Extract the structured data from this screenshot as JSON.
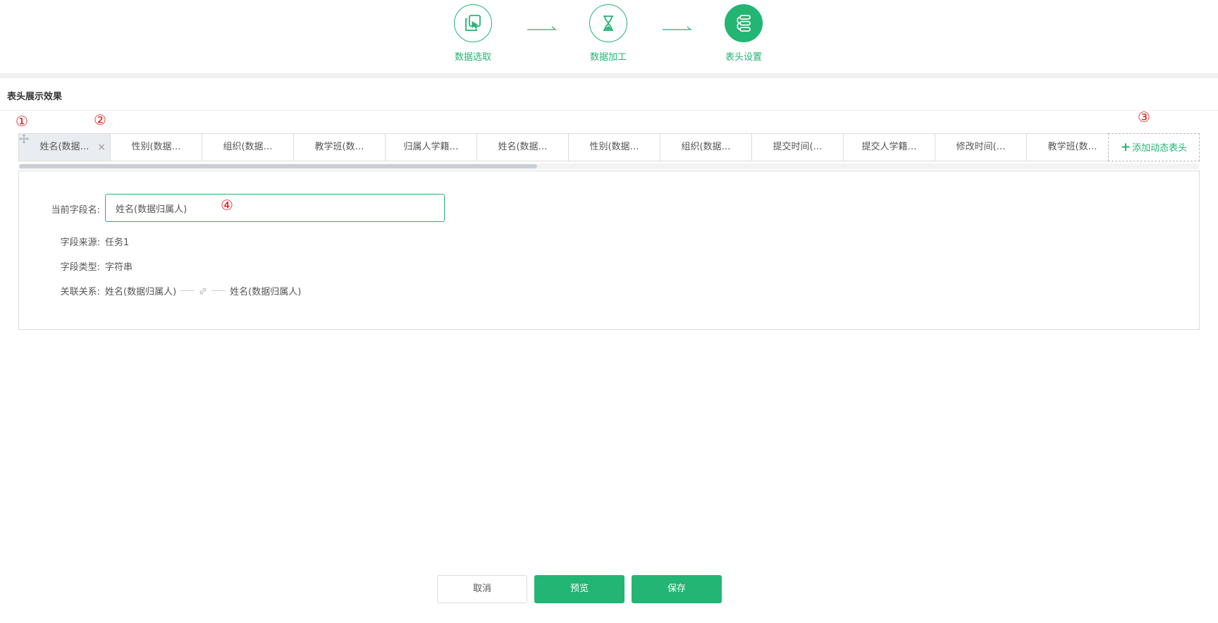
{
  "colors": {
    "accent": "#22b573",
    "marker": "#e02020"
  },
  "steps": [
    {
      "label": "数据选取",
      "icon": "copy-cursor-icon",
      "active": false
    },
    {
      "label": "数据加工",
      "icon": "hourglass-icon",
      "active": false
    },
    {
      "label": "表头设置",
      "icon": "link-list-icon",
      "active": true
    }
  ],
  "section": {
    "title": "表头展示效果"
  },
  "markers": [
    "①",
    "②",
    "③",
    "④"
  ],
  "columns": [
    "姓名(数据…",
    "性别(数据…",
    "组织(数据…",
    "教学班(数…",
    "归属人学籍…",
    "姓名(数据…",
    "性别(数据…",
    "组织(数据…",
    "提交时间(…",
    "提交人学籍…",
    "修改时间(…",
    "教学班(数…"
  ],
  "selected_column_close": "×",
  "add_dynamic": {
    "plus": "+",
    "label": "添加动态表头"
  },
  "detail": {
    "field_name_label": "当前字段名:",
    "field_name_value": "姓名(数据归属人)",
    "source_label": "字段来源:",
    "source_value": "任务1",
    "type_label": "字段类型:",
    "type_value": "字符串",
    "relation_label": "关联关系:",
    "relation_left": "姓名(数据归属人)",
    "relation_right": "姓名(数据归属人)"
  },
  "footer": {
    "cancel": "取消",
    "preview": "预览",
    "save": "保存"
  }
}
